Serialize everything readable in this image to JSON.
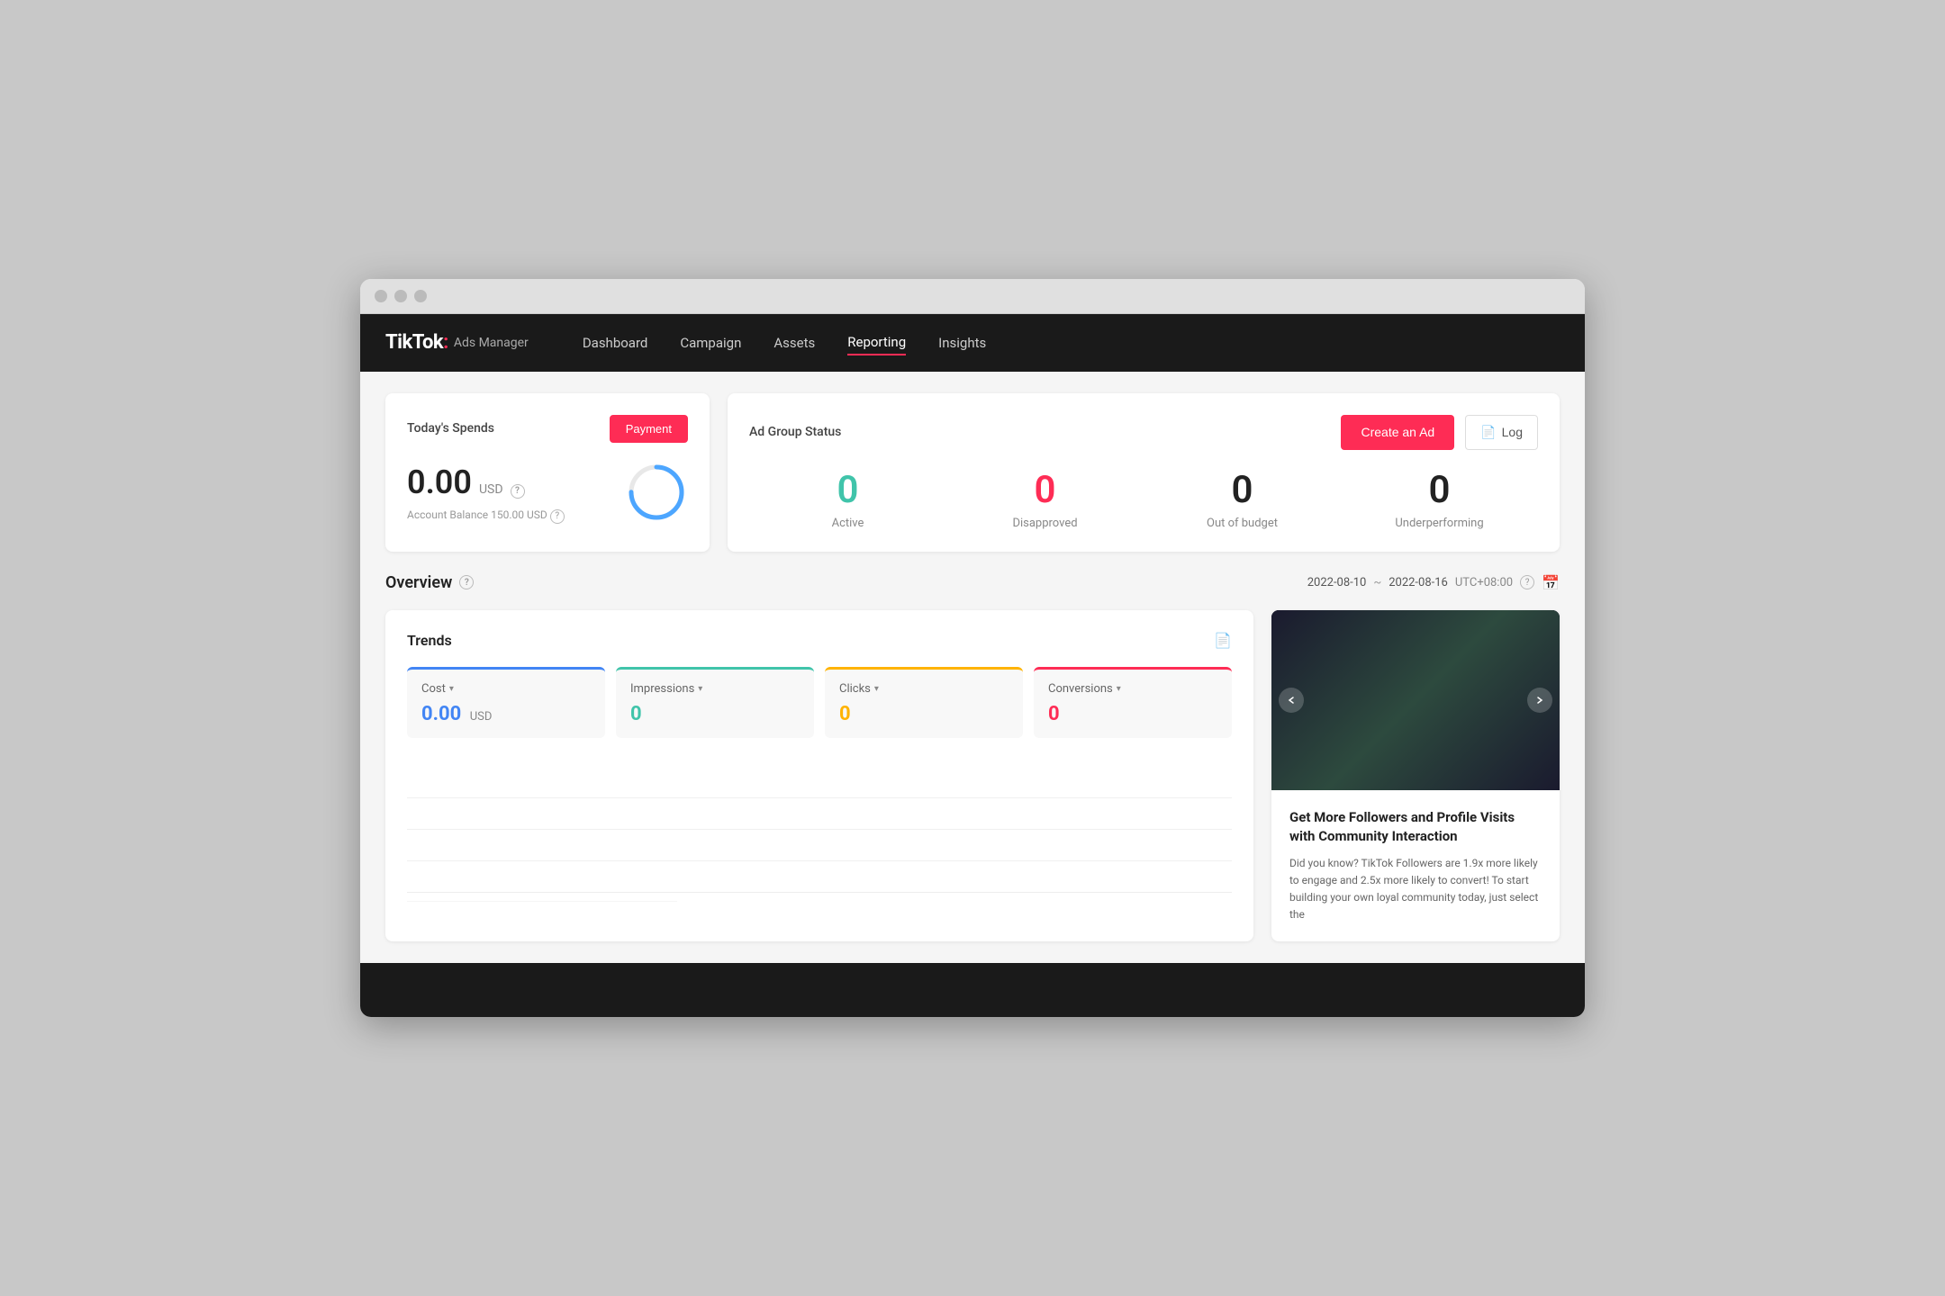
{
  "browser": {
    "dots": [
      "dot1",
      "dot2",
      "dot3"
    ]
  },
  "nav": {
    "logo_tiktok": "TikTok",
    "logo_colon": ":",
    "logo_subtitle": "Ads Manager",
    "items": [
      {
        "label": "Dashboard",
        "active": false
      },
      {
        "label": "Campaign",
        "active": false
      },
      {
        "label": "Assets",
        "active": false
      },
      {
        "label": "Reporting",
        "active": true
      },
      {
        "label": "Insights",
        "active": false
      }
    ]
  },
  "spends": {
    "title": "Today's Spends",
    "payment_label": "Payment",
    "amount": "0.00",
    "currency": "USD",
    "balance_label": "Account Balance",
    "balance_amount": "150.00",
    "balance_currency": "USD"
  },
  "adgroup": {
    "title": "Ad Group Status",
    "create_label": "Create an Ad",
    "log_label": "Log",
    "stats": [
      {
        "number": "0",
        "label": "Active",
        "color": "active"
      },
      {
        "number": "0",
        "label": "Disapproved",
        "color": "disapproved"
      },
      {
        "number": "0",
        "label": "Out of budget",
        "color": "normal"
      },
      {
        "number": "0",
        "label": "Underperforming",
        "color": "normal"
      }
    ]
  },
  "overview": {
    "title": "Overview",
    "date_start": "2022-08-10",
    "date_separator": "~",
    "date_end": "2022-08-16",
    "timezone": "UTC+08:00"
  },
  "trends": {
    "title": "Trends",
    "metrics": [
      {
        "key": "cost",
        "label": "Cost",
        "value": "0.00",
        "unit": "USD",
        "color_class": "cost"
      },
      {
        "key": "impressions",
        "label": "Impressions",
        "value": "0",
        "unit": "",
        "color_class": "impressions"
      },
      {
        "key": "clicks",
        "label": "Clicks",
        "value": "0",
        "unit": "",
        "color_class": "clicks"
      },
      {
        "key": "conversions",
        "label": "Conversions",
        "value": "0",
        "unit": "",
        "color_class": "conversions"
      }
    ]
  },
  "promo": {
    "title": "Get More Followers and Profile Visits with Community Interaction",
    "text": "Did you know? TikTok Followers are 1.9x more likely to engage and 2.5x more likely to convert! To start building your own loyal community today, just select the"
  }
}
